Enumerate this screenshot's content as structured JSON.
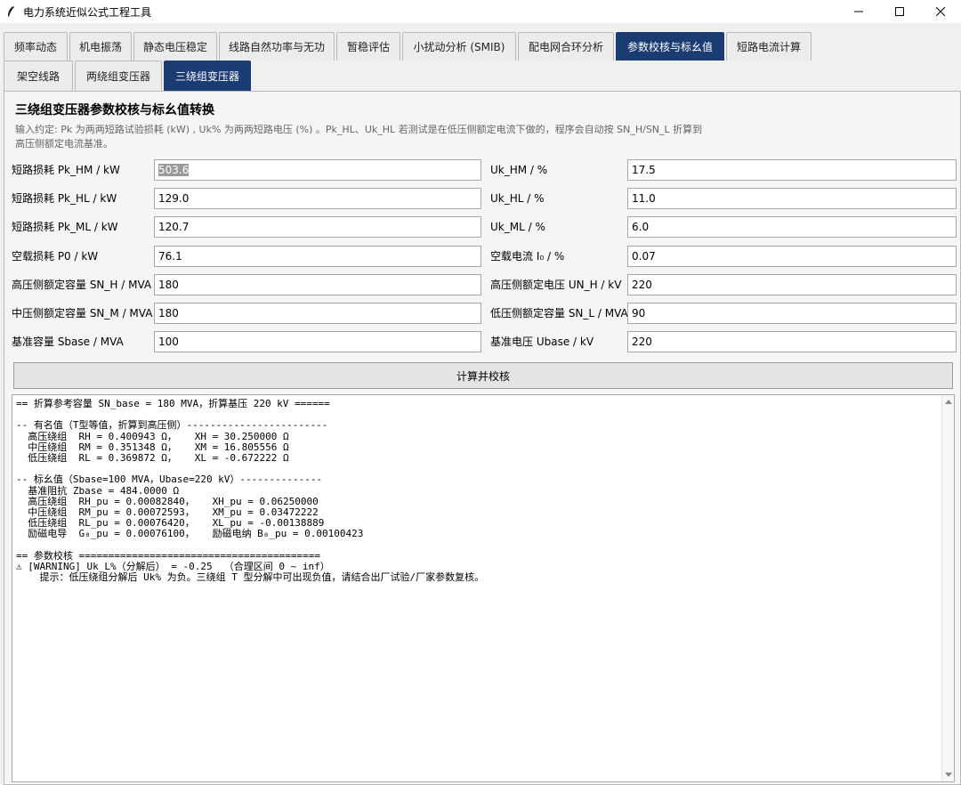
{
  "window": {
    "title": "电力系统近似公式工程工具"
  },
  "main_tabs": [
    {
      "label": "频率动态",
      "width": 72
    },
    {
      "label": "机电振荡",
      "width": 70
    },
    {
      "label": "静态电压稳定",
      "width": 94
    },
    {
      "label": "线路自然功率与无功",
      "width": 130
    },
    {
      "label": "暂稳评估",
      "width": 72
    },
    {
      "label": "小扰动分析 (SMIB)",
      "width": 128
    },
    {
      "label": "配电网合环分析",
      "width": 108
    },
    {
      "label": "参数校核与标幺值",
      "width": 122,
      "active": true
    },
    {
      "label": "短路电流计算",
      "width": 96
    }
  ],
  "sub_tabs": [
    {
      "label": "架空线路",
      "width": 78
    },
    {
      "label": "两绕组变压器",
      "width": 98
    },
    {
      "label": "三绕组变压器",
      "width": 98,
      "active": true
    }
  ],
  "panel": {
    "heading": "三绕组变压器参数校核与标幺值转换",
    "hint": "输入约定: Pk 为两两短路试验损耗 (kW) , Uk% 为两两短路电压 (%) 。Pk_HL、Uk_HL 若测试是在低压侧额定电流下做的，程序会自动按 SN_H/SN_L 折算到高压侧额定电流基准。"
  },
  "fields_left": [
    {
      "label": "短路损耗 Pk_HM / kW",
      "value": "503.6",
      "selected": true
    },
    {
      "label": "短路损耗 Pk_HL / kW",
      "value": "129.0"
    },
    {
      "label": "短路损耗 Pk_ML / kW",
      "value": "120.7"
    },
    {
      "label": "空载损耗 P0 / kW",
      "value": "76.1"
    },
    {
      "label": "高压侧额定容量 SN_H / MVA",
      "value": "180"
    },
    {
      "label": "中压侧额定容量 SN_M / MVA",
      "value": "180"
    },
    {
      "label": "基准容量 Sbase / MVA",
      "value": "100"
    }
  ],
  "fields_right": [
    {
      "label": "Uk_HM / %",
      "value": "17.5"
    },
    {
      "label": "Uk_HL / %",
      "value": "11.0"
    },
    {
      "label": "Uk_ML / %",
      "value": "6.0"
    },
    {
      "label": "空载电流 I₀ / %",
      "value": "0.07"
    },
    {
      "label": "高压侧额定电压 UN_H / kV",
      "value": "220"
    },
    {
      "label": "低压侧额定容量 SN_L / MVA",
      "value": "90"
    },
    {
      "label": "基准电压 Ubase / kV",
      "value": "220"
    }
  ],
  "calc_button": {
    "label": "计算并校核"
  },
  "output_text": "== 折算参考容量 SN_base = 180 MVA，折算基压 220 kV ======\n\n-- 有名值（T型等值，折算到高压侧）------------------------\n  高压绕组  RH = 0.400943 Ω，   XH = 30.250000 Ω\n  中压绕组  RM = 0.351348 Ω，   XM = 16.805556 Ω\n  低压绕组  RL = 0.369872 Ω，   XL = -0.672222 Ω\n\n-- 标幺值（Sbase=100 MVA，Ubase=220 kV）--------------\n  基准阻抗 Zbase = 484.0000 Ω\n  高压绕组  RH_pu = 0.00082840，   XH_pu = 0.06250000\n  中压绕组  RM_pu = 0.00072593，   XM_pu = 0.03472222\n  低压绕组  RL_pu = 0.00076420，   XL_pu = -0.00138889\n  励磁电导  G₀_pu = 0.00076100，   励磁电纳 B₀_pu = 0.00100423\n\n== 参数校核 =========================================\n⚠ [WARNING] Uk_L%（分解后） = -0.25  （合理区间 0 ~ inf）\n    提示：低压绕组分解后 Uk% 为负。三绕组 T 型分解中可出现负值，请结合出厂试验/厂家参数复核。"
}
